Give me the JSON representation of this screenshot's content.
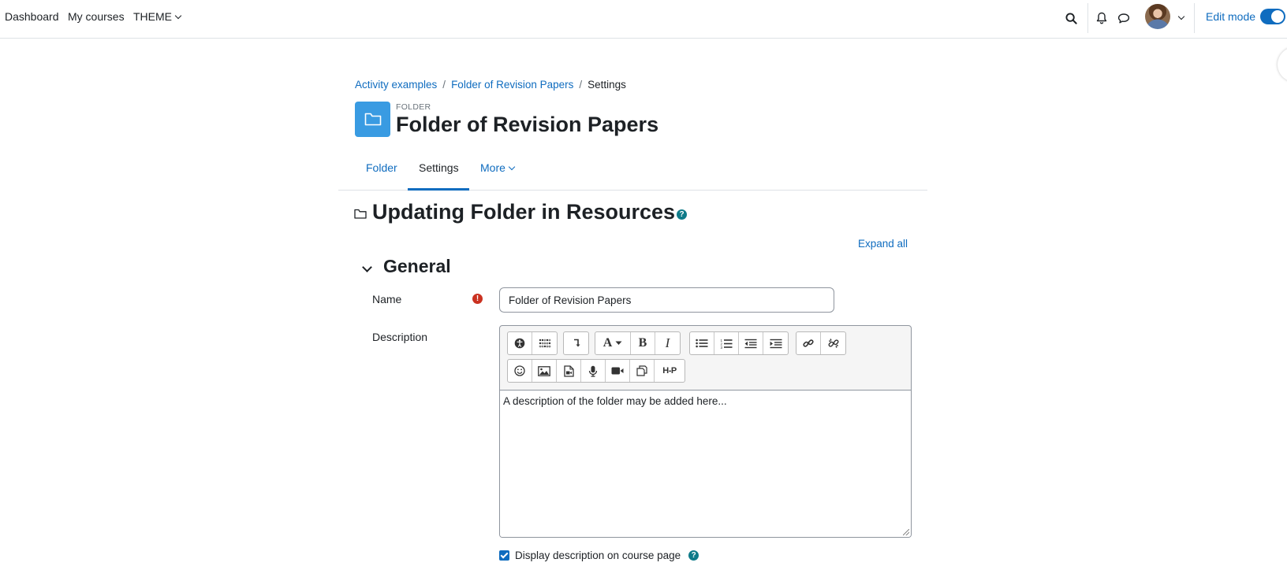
{
  "navbar": {
    "links": [
      "Dashboard",
      "My courses",
      "THEME"
    ],
    "edit_mode_label": "Edit mode",
    "edit_mode_on": true
  },
  "breadcrumb": {
    "items": [
      "Activity examples",
      "Folder of Revision Papers",
      "Settings"
    ]
  },
  "header": {
    "activity_type": "FOLDER",
    "title": "Folder of Revision Papers",
    "icon": "folder-icon",
    "icon_color": "#399be2"
  },
  "secondary_nav": {
    "tabs": [
      "Folder",
      "Settings",
      "More"
    ],
    "active_tab": "Settings"
  },
  "form": {
    "title": "Updating Folder in Resources",
    "expand_all": "Expand all",
    "section_title": "General",
    "name_label": "Name",
    "name_value": "Folder of Revision Papers",
    "description_label": "Description",
    "description_text": "A description of the folder may be added here...",
    "display_description_label": "Display description on course page",
    "display_description_checked": true
  },
  "toolbar": {
    "h5p_label": "H-P",
    "bold_label": "B",
    "italic_label": "I",
    "font_label": "A"
  },
  "colors": {
    "accent": "#0f6cbf",
    "required": "#ca3120",
    "help": "#0f7b89"
  }
}
